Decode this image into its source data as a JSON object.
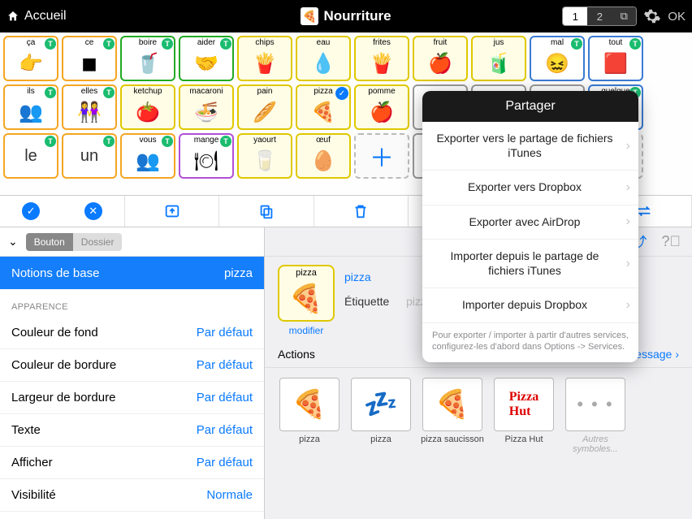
{
  "topbar": {
    "home": "Accueil",
    "title": "Nourriture",
    "page1": "1",
    "page2": "2",
    "ok": "OK"
  },
  "board": {
    "row1": [
      {
        "label": "ça",
        "border": "orange",
        "glyph": "👉",
        "badge": "T"
      },
      {
        "label": "ce",
        "border": "orange",
        "glyph": "◼",
        "badge": "T"
      },
      {
        "label": "boire",
        "border": "green",
        "glyph": "🥤",
        "badge": "T"
      },
      {
        "label": "aider",
        "border": "green",
        "glyph": "🤝",
        "badge": "T"
      },
      {
        "label": "chips",
        "border": "yellow",
        "glyph": "🍟"
      },
      {
        "label": "eau",
        "border": "yellow",
        "glyph": "💧"
      },
      {
        "label": "frites",
        "border": "yellow",
        "glyph": "🍟"
      },
      {
        "label": "fruit",
        "border": "yellow",
        "glyph": "🍎"
      },
      {
        "label": "jus",
        "border": "yellow",
        "glyph": "🧃"
      },
      {
        "label": "mal",
        "border": "blue",
        "glyph": "😖",
        "badge": "T"
      },
      {
        "label": "tout",
        "border": "blue",
        "glyph": "🟥",
        "badge": "T"
      }
    ],
    "row2": [
      {
        "label": "ils",
        "border": "orange",
        "glyph": "👥",
        "badge": "T"
      },
      {
        "label": "elles",
        "border": "orange",
        "glyph": "👭",
        "badge": "T"
      },
      {
        "label": "ketchup",
        "border": "yellow",
        "glyph": "🍅"
      },
      {
        "label": "macaroni",
        "border": "yellow",
        "glyph": "🍜"
      },
      {
        "label": "pain",
        "border": "yellow",
        "glyph": "🥖"
      },
      {
        "label": "pizza",
        "border": "yellow",
        "glyph": "🍕",
        "check": true
      },
      {
        "label": "pomme",
        "border": "yellow",
        "glyph": "🍎"
      },
      {
        "label": "",
        "border": "gray",
        "glyph": ""
      },
      {
        "label": "",
        "border": "gray",
        "glyph": ""
      },
      {
        "label": "",
        "border": "gray",
        "glyph": ""
      },
      {
        "label": "quelque",
        "border": "blue",
        "glyph": "🥛",
        "badge": "T"
      }
    ],
    "row3": [
      {
        "label": "",
        "text": "le",
        "border": "orange",
        "badge": "T"
      },
      {
        "label": "",
        "text": "un",
        "border": "orange",
        "badge": "T"
      },
      {
        "label": "vous",
        "border": "orange",
        "glyph": "👥",
        "badge": "T"
      },
      {
        "label": "mange",
        "border": "purple",
        "glyph": "🍽",
        "badge": "T"
      },
      {
        "label": "yaourt",
        "border": "yellow",
        "glyph": "🥛"
      },
      {
        "label": "œuf",
        "border": "yellow",
        "glyph": "🥚"
      },
      {
        "ghost": true,
        "plus": true
      },
      {
        "label": "",
        "border": "gray",
        "glyph": ""
      },
      {
        "label": "",
        "border": "gray",
        "glyph": ""
      },
      {
        "label": "",
        "border": "gray",
        "glyph": ""
      },
      {
        "ghost": true
      }
    ]
  },
  "toolbar": {
    "move1": "→1",
    "move2": "→2"
  },
  "sidebar": {
    "seg_button": "Bouton",
    "seg_folder": "Dossier",
    "category": "Notions de base",
    "selected": "pizza",
    "section": "Apparence",
    "rows": [
      {
        "label": "Couleur de fond",
        "value": "Par défaut"
      },
      {
        "label": "Couleur de bordure",
        "value": "Par défaut"
      },
      {
        "label": "Largeur de bordure",
        "value": "Par défaut"
      },
      {
        "label": "Texte",
        "value": "Par défaut"
      },
      {
        "label": "Afficher",
        "value": "Par défaut"
      },
      {
        "label": "Visibilité",
        "value": "Normale"
      }
    ]
  },
  "detail": {
    "preview_label": "pizza",
    "modifier": "modifier",
    "name_value": "pizza",
    "etiquette_label": "Étiquette",
    "etiquette_placeholder": "pizza",
    "actions_label": "Actions",
    "actions_add": "Ajouter du texte au message",
    "symbols": [
      {
        "label": "pizza",
        "glyph": "🍕"
      },
      {
        "label": "pizza",
        "glyph": "💤"
      },
      {
        "label": "pizza saucisson",
        "glyph": "🍕"
      },
      {
        "label": "Pizza Hut",
        "glyph": "PH"
      },
      {
        "label": "Autres symboles...",
        "more": true
      }
    ]
  },
  "popover": {
    "title": "Partager",
    "items": [
      "Exporter vers le partage de fichiers iTunes",
      "Exporter vers Dropbox",
      "Exporter avec AirDrop",
      "Importer depuis le partage de fichiers iTunes",
      "Importer depuis Dropbox"
    ],
    "footer": "Pour exporter / importer à partir d'autres services, configurez-les d'abord dans Options -> Services."
  }
}
